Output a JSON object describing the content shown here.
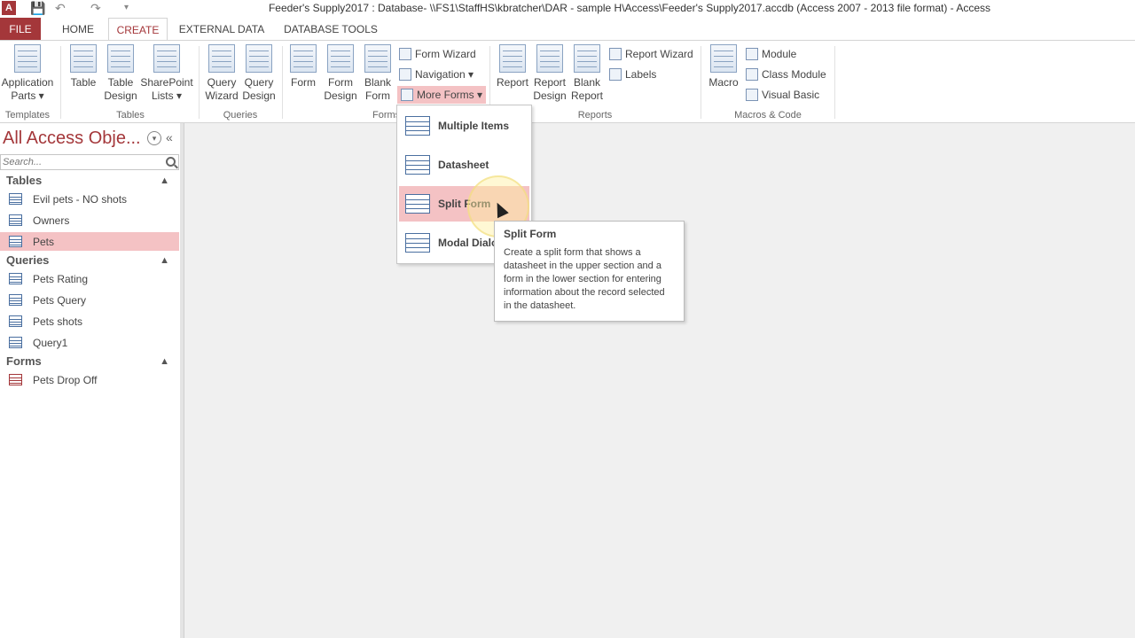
{
  "window": {
    "app_icon": "A",
    "title": "Feeder's Supply2017 : Database- \\\\FS1\\StaffHS\\kbratcher\\DAR - sample H\\Access\\Feeder's Supply2017.accdb (Access 2007 - 2013 file format) - Access"
  },
  "tabs": [
    {
      "label": "FILE"
    },
    {
      "label": "HOME"
    },
    {
      "label": "CREATE"
    },
    {
      "label": "EXTERNAL DATA"
    },
    {
      "label": "DATABASE TOOLS"
    }
  ],
  "ribbon": {
    "templates": {
      "label": "Templates",
      "application_parts": "Application Parts"
    },
    "tables": {
      "label": "Tables",
      "table": "Table",
      "table_design": "Table Design",
      "sharepoint_lists": "SharePoint Lists"
    },
    "queries": {
      "label": "Queries",
      "query_wizard": "Query Wizard",
      "query_design": "Query Design"
    },
    "forms": {
      "label": "Forms",
      "form": "Form",
      "form_design": "Form Design",
      "blank_form": "Blank Form",
      "form_wizard": "Form Wizard",
      "navigation": "Navigation",
      "more_forms": "More Forms"
    },
    "reports": {
      "label": "Reports",
      "report": "Report",
      "report_design": "Report Design",
      "blank_report": "Blank Report",
      "report_wizard": "Report Wizard",
      "labels": "Labels"
    },
    "macros": {
      "label": "Macros & Code",
      "macro": "Macro",
      "module": "Module",
      "class_module": "Class Module",
      "visual_basic": "Visual Basic"
    }
  },
  "navpane": {
    "title": "All Access Obje...",
    "search_placeholder": "Search...",
    "tables_header": "Tables",
    "tables": [
      "Evil pets - NO shots",
      "Owners",
      "Pets"
    ],
    "queries_header": "Queries",
    "queries": [
      "Pets Rating",
      "Pets Query",
      "Pets shots",
      "Query1"
    ],
    "forms_header": "Forms",
    "forms": [
      "Pets Drop Off"
    ]
  },
  "more_forms_menu": {
    "items": [
      "Multiple Items",
      "Datasheet",
      "Split Form",
      "Modal Dialog"
    ]
  },
  "tooltip": {
    "title": "Split Form",
    "body": "Create a split form that shows a datasheet in the upper section and a form in the lower section for entering information about the record selected in the datasheet."
  }
}
